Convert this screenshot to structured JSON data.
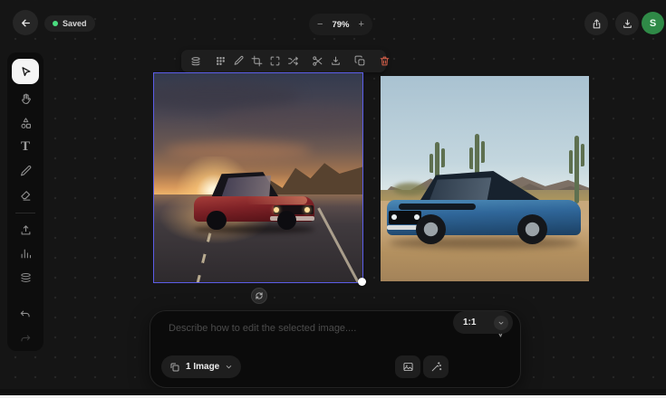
{
  "header": {
    "saved_label": "Saved",
    "zoom": {
      "minus": "−",
      "level": "79%",
      "plus": "+"
    },
    "avatar_initial": "S"
  },
  "sidebar": {
    "text_tool_glyph": "T"
  },
  "canvas": {
    "selection_color": "#5b5de8",
    "images": [
      {
        "name": "sunset-muscle-car",
        "selected": true
      },
      {
        "name": "blue-mustang-desert",
        "selected": false
      }
    ]
  },
  "prompt": {
    "placeholder": "Describe how to edit the selected image....",
    "image_count_label": "1 Image",
    "aspect_ratio_label": "1:1"
  },
  "colors": {
    "accent_green": "#4ade80",
    "avatar_green": "#2f8a47",
    "danger_red": "#d9604a",
    "selection_blue": "#5b5de8",
    "background": "#151515"
  }
}
